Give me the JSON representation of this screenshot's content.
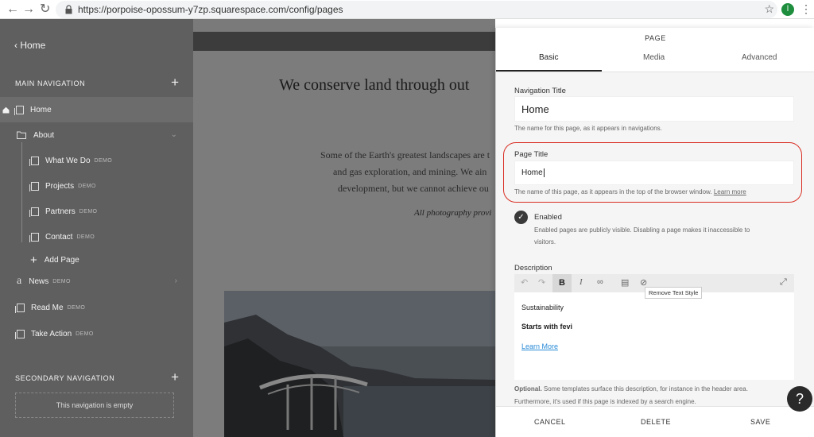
{
  "browser": {
    "back": "←",
    "forward": "→",
    "reload": "↻",
    "url": "https://porpoise-opossum-y7zp.squarespace.com/config/pages",
    "star": "☆",
    "profile_initial": "l",
    "menu": "⋮"
  },
  "sidebar": {
    "back_label": "Home",
    "main_nav_label": "MAIN NAVIGATION",
    "plus": "+",
    "items": [
      {
        "label": "Home",
        "demo": ""
      },
      {
        "label": "About",
        "demo": ""
      },
      {
        "label": "What We Do",
        "demo": "DEMO"
      },
      {
        "label": "Projects",
        "demo": "DEMO"
      },
      {
        "label": "Partners",
        "demo": "DEMO"
      },
      {
        "label": "Contact",
        "demo": "DEMO"
      },
      {
        "label": "Add Page",
        "demo": ""
      },
      {
        "label": "News",
        "demo": "DEMO"
      },
      {
        "label": "Read Me",
        "demo": "DEMO"
      },
      {
        "label": "Take Action",
        "demo": "DEMO"
      }
    ],
    "secondary_nav_label": "SECONDARY NAVIGATION",
    "empty_text": "This navigation is empty"
  },
  "preview": {
    "heading": "We conserve land through out",
    "lines": [
      "Some of the Earth's greatest landscapes are t",
      "and gas exploration, and mining. We ain",
      "development, but we cannot achieve ou"
    ],
    "caption": "All photography provi"
  },
  "panel": {
    "title": "PAGE",
    "tabs": [
      "Basic",
      "Media",
      "Advanced"
    ],
    "nav_title_label": "Navigation Title",
    "nav_title_value": "Home",
    "nav_title_help": "The name for this page, as it appears in navigations.",
    "page_title_label": "Page Title",
    "page_title_value": "Home",
    "page_title_help": "The name of this page, as it appears in the top of the browser window.",
    "learn_more": "Learn more",
    "enabled_label": "Enabled",
    "enabled_help_1": "Enabled pages are publicly visible. Disabling a page makes it inaccessible to",
    "enabled_help_2": "visitors.",
    "description_label": "Description",
    "tooltip": "Remove Text Style",
    "editor_lines": [
      "Sustainability",
      "Starts with fevi",
      "Learn More"
    ],
    "optional_label": "Optional.",
    "optional_help_1": "Some templates surface this description, for instance in the header area.",
    "optional_help_2": "Furthermore, it's used if this page is indexed by a search engine.",
    "cancel": "CANCEL",
    "delete": "DELETE",
    "save": "SAVE"
  },
  "help_button": "?",
  "colors": {
    "highlight": "#d93025",
    "link": "#2a8bd8",
    "sidebar_bg": "#5f5f5f"
  }
}
